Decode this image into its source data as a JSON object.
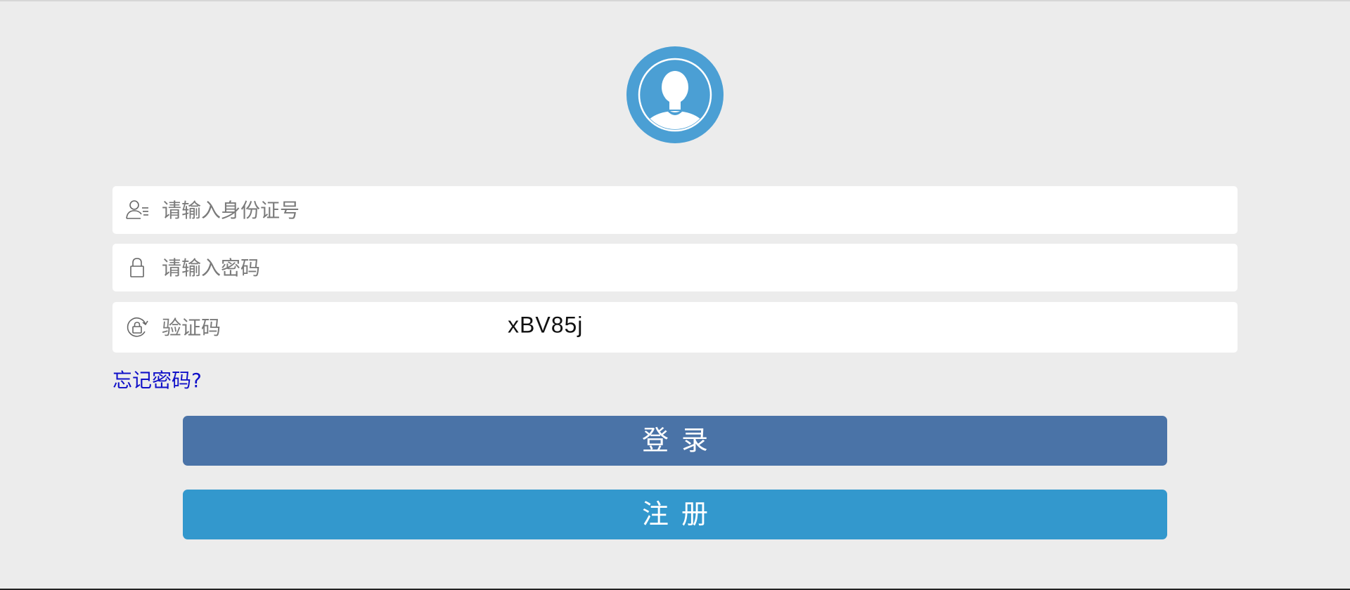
{
  "form": {
    "id_placeholder": "请输入身份证号",
    "password_placeholder": "请输入密码",
    "captcha_placeholder": "验证码",
    "captcha_code": "xBV85j"
  },
  "links": {
    "forgot_password": "忘记密码?"
  },
  "buttons": {
    "login": "登录",
    "register": "注册"
  },
  "icons": {
    "avatar": "user-avatar-icon",
    "id": "id-card-user-icon",
    "password": "lock-icon",
    "captcha": "refresh-lock-icon"
  },
  "colors": {
    "background": "#ececec",
    "avatar": "#4b9fd4",
    "login_button": "#4a73a7",
    "register_button": "#3398cd",
    "link": "#1010c8"
  }
}
